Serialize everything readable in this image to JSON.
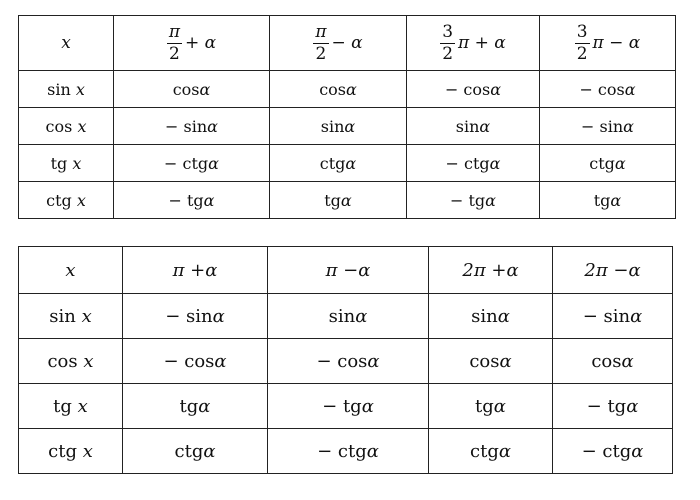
{
  "table1": {
    "header": {
      "x": "x",
      "c1": {
        "num": "π",
        "den": "2",
        "rest": "+ α"
      },
      "c2": {
        "num": "π",
        "den": "2",
        "rest": "− α"
      },
      "c3": {
        "num": "3",
        "den": "2",
        "rest": "π + α"
      },
      "c4": {
        "num": "3",
        "den": "2",
        "rest": "π − α"
      }
    },
    "rows": [
      {
        "label": [
          "sin",
          "x"
        ],
        "cells": [
          "cosα",
          "cosα",
          "− cosα",
          "− cosα"
        ]
      },
      {
        "label": [
          "cos",
          "x"
        ],
        "cells": [
          "− sinα",
          "sinα",
          "sinα",
          "− sinα"
        ]
      },
      {
        "label": [
          "tg",
          "x"
        ],
        "cells": [
          "− ctgα",
          "ctgα",
          "− ctgα",
          "ctgα"
        ]
      },
      {
        "label": [
          "ctg",
          "x"
        ],
        "cells": [
          "− tgα",
          "tgα",
          "− tgα",
          "tgα"
        ]
      }
    ]
  },
  "table2": {
    "header": [
      "x",
      "π +α",
      "π −α",
      "2π +α",
      "2π −α"
    ],
    "rows": [
      {
        "label": [
          "sin",
          "x"
        ],
        "cells": [
          "− sinα",
          "sinα",
          "sinα",
          "− sinα"
        ]
      },
      {
        "label": [
          "cos",
          "x"
        ],
        "cells": [
          "− cosα",
          "− cosα",
          "cosα",
          "cosα"
        ]
      },
      {
        "label": [
          "tg",
          "x"
        ],
        "cells": [
          "tgα",
          "− tgα",
          "tgα",
          "− tgα"
        ]
      },
      {
        "label": [
          "ctg",
          "x"
        ],
        "cells": [
          "ctgα",
          "− ctgα",
          "ctgα",
          "− ctgα"
        ]
      }
    ]
  }
}
